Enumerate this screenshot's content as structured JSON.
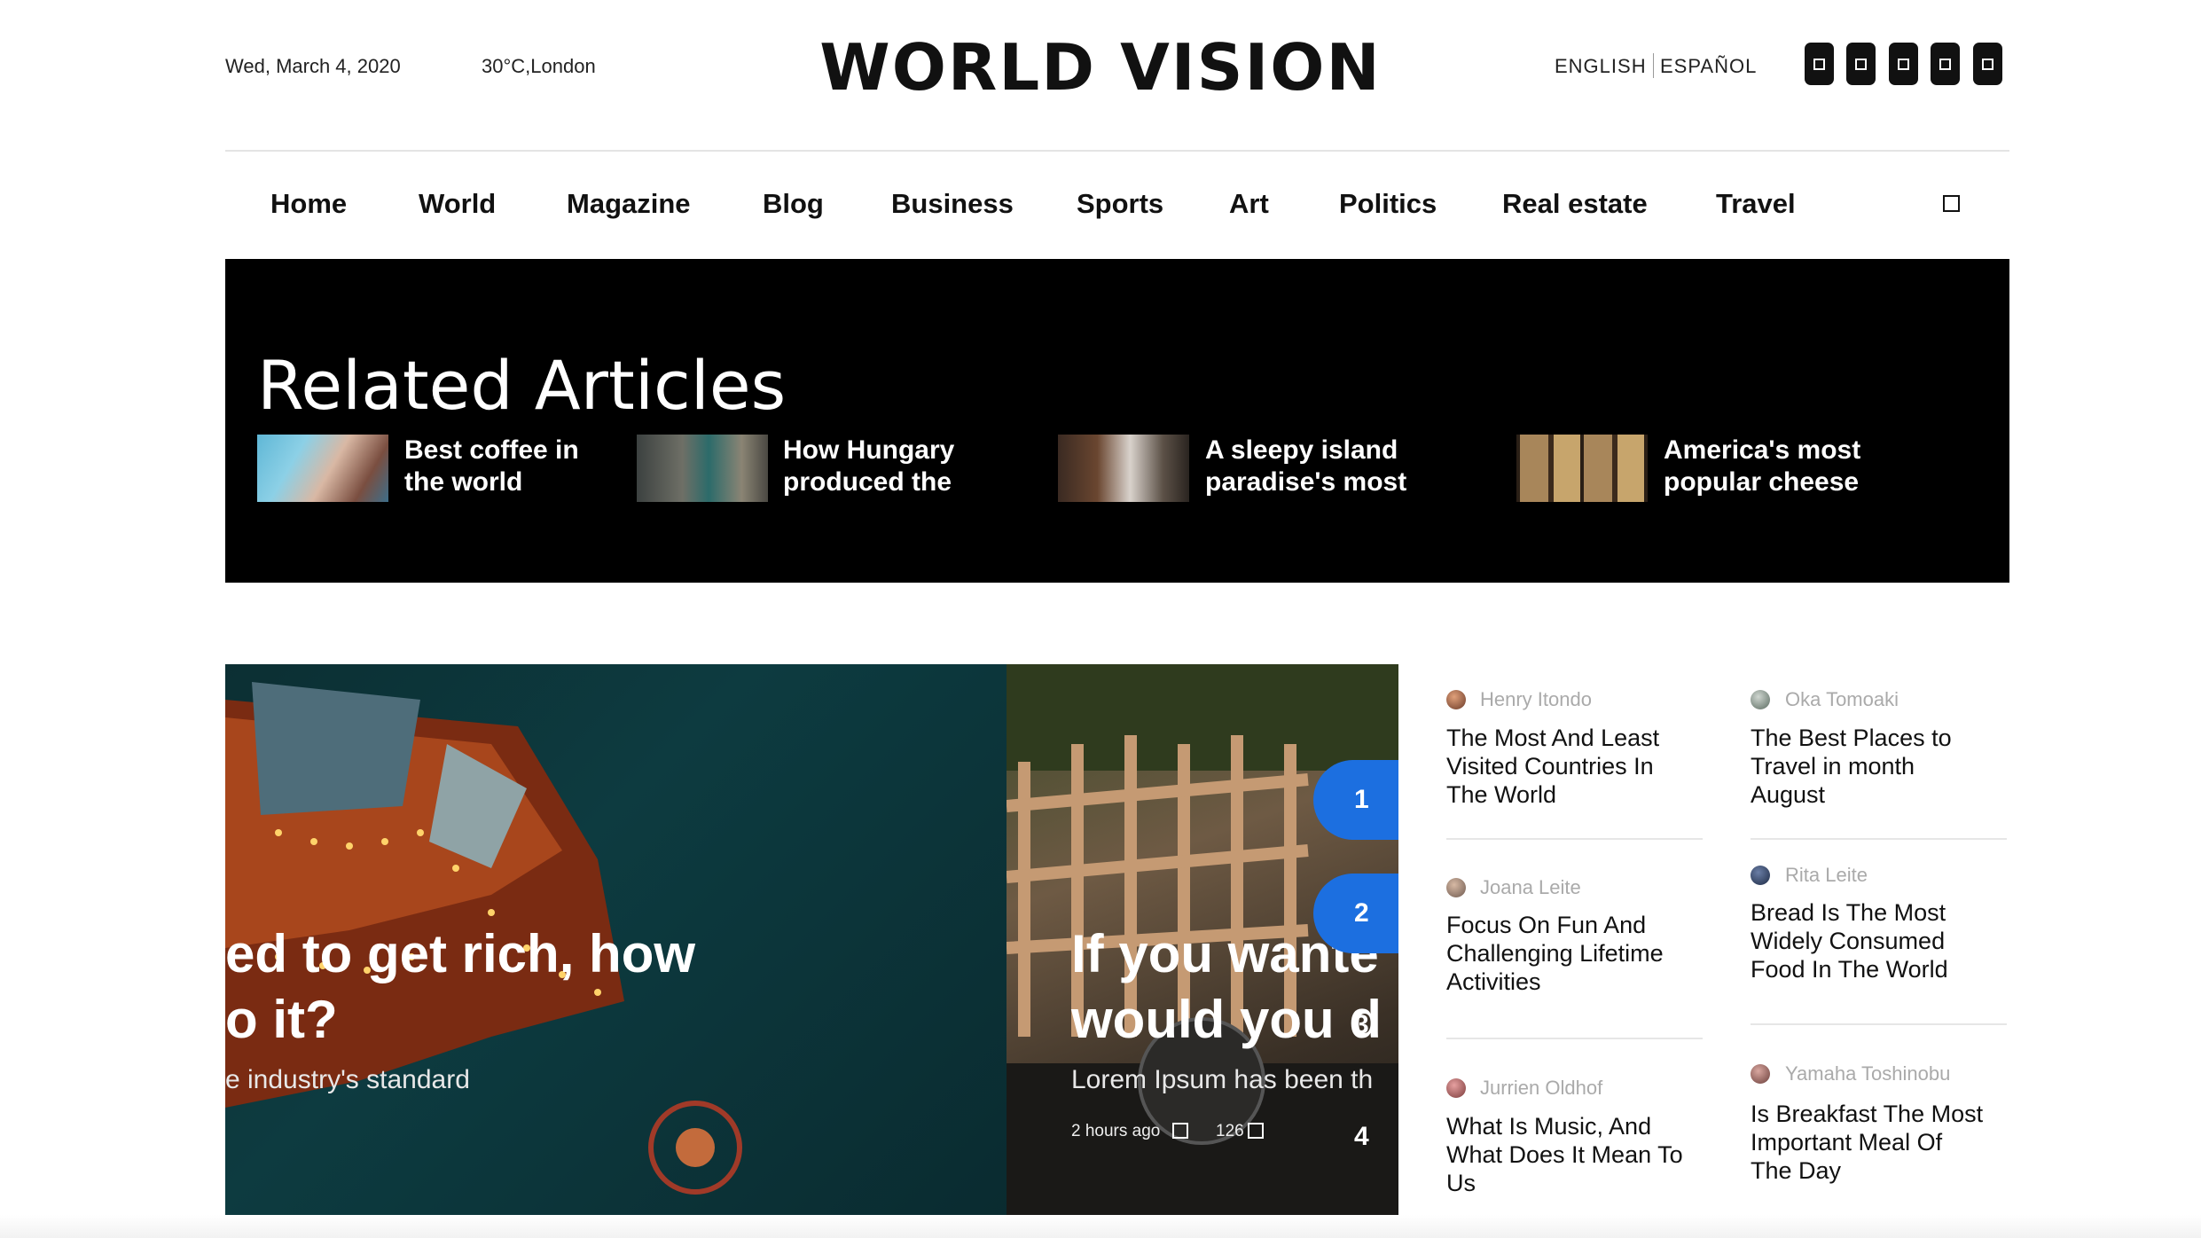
{
  "header": {
    "date": "Wed, March 4, 2020",
    "weather": "30°C,London",
    "logo": "WORLD VISION",
    "languages": [
      "ENGLISH",
      "ESPAÑOL"
    ],
    "social_icons": [
      "social-icon-1",
      "social-icon-2",
      "social-icon-3",
      "social-icon-4",
      "social-icon-5"
    ]
  },
  "nav": {
    "items": [
      "Home",
      "World",
      "Magazine",
      "Blog",
      "Business",
      "Sports",
      "Art",
      "Politics",
      "Real estate",
      "Travel"
    ],
    "search_icon": "search-icon"
  },
  "related": {
    "title": "Related Articles",
    "items": [
      {
        "line1": "Best coffee in",
        "line2": "the world"
      },
      {
        "line1": "How Hungary",
        "line2": "produced the"
      },
      {
        "line1": "A sleepy island",
        "line2": "paradise's most"
      },
      {
        "line1": "America's most",
        "line2": "popular cheese"
      }
    ]
  },
  "hero": {
    "left": {
      "line1": "ed to get rich, how",
      "line2": "o it?",
      "sub": "e industry's standard"
    },
    "right": {
      "line1": "If you wante",
      "line2": "would you d",
      "sub": "Lorem Ipsum has been th",
      "time": "2 hours ago",
      "comments": "126"
    },
    "slides": [
      "1",
      "2",
      "3",
      "4"
    ]
  },
  "side": {
    "col1": [
      {
        "author": "Henry Itondo",
        "title": [
          "The Most And Least",
          "Visited Countries In",
          "The World"
        ]
      },
      {
        "author": "Joana Leite",
        "title": [
          "Focus On Fun And",
          "Challenging Lifetime",
          "Activities"
        ]
      },
      {
        "author": "Jurrien Oldhof",
        "title": [
          "What Is Music, And",
          "What Does It Mean To",
          "Us"
        ]
      }
    ],
    "col2": [
      {
        "author": "Oka Tomoaki",
        "title": [
          "The Best Places to",
          "Travel in month",
          "August"
        ]
      },
      {
        "author": "Rita Leite",
        "title": [
          "Bread Is The Most",
          "Widely Consumed",
          "Food In The World"
        ]
      },
      {
        "author": "Yamaha Toshinobu",
        "title": [
          "Is Breakfast The Most",
          "Important Meal Of",
          "The Day"
        ]
      }
    ]
  },
  "colors": {
    "accent": "#1c6fe0",
    "band": "#000000",
    "text": "#111111"
  }
}
